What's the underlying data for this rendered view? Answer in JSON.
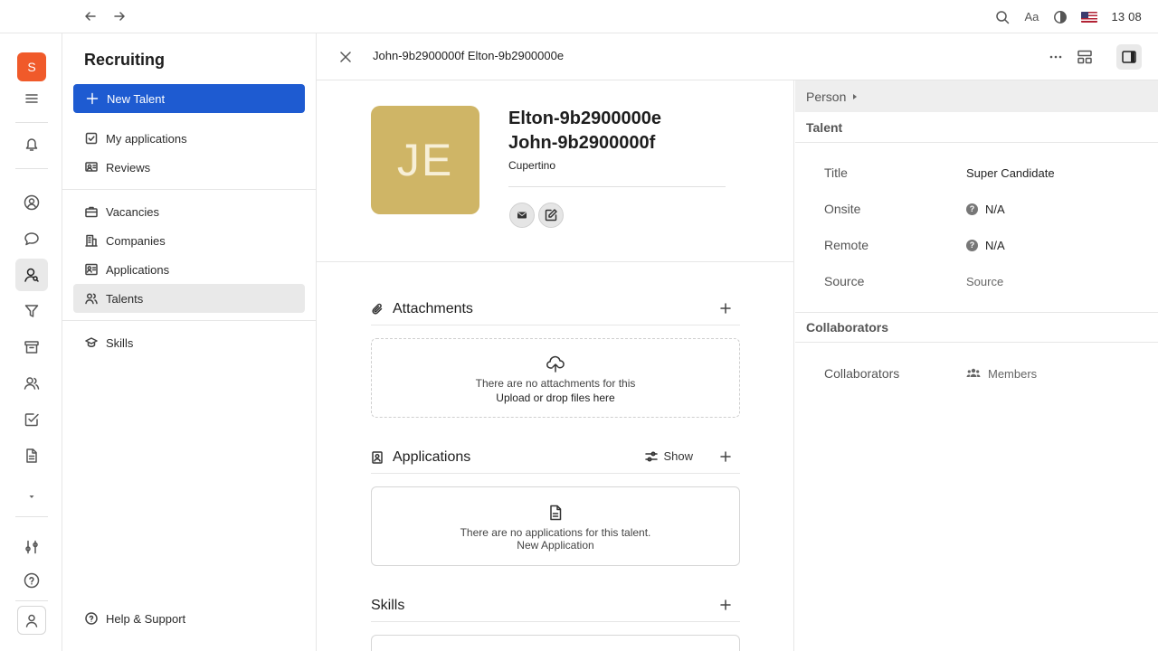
{
  "topbar": {
    "back_icon": "arrow-left-icon",
    "forward_icon": "arrow-right-icon",
    "font_label": "Aa",
    "time": "13 08",
    "flag": "us-flag"
  },
  "rail": {
    "workspace_initial": "S",
    "workspace_color": "#f05a2a",
    "active_item": "recruiting"
  },
  "sidebar": {
    "title": "Recruiting",
    "new_button": "New Talent",
    "items": [
      {
        "label": "My applications",
        "icon": "checkbox-icon"
      },
      {
        "label": "Reviews",
        "icon": "reviews-icon"
      },
      {
        "label": "Vacancies",
        "icon": "briefcase-icon"
      },
      {
        "label": "Companies",
        "icon": "building-icon"
      },
      {
        "label": "Applications",
        "icon": "id-card-icon"
      },
      {
        "label": "Talents",
        "icon": "people-icon",
        "active": true
      },
      {
        "label": "Skills",
        "icon": "graduation-cap-icon"
      }
    ],
    "help": "Help & Support"
  },
  "header": {
    "title": "John-9b2900000f Elton-9b2900000e"
  },
  "talent": {
    "initials": "JE",
    "avatar_color": "#cfb566",
    "last_name": "Elton-9b2900000e",
    "first_name": "John-9b2900000f",
    "location": "Cupertino"
  },
  "attachments": {
    "title": "Attachments",
    "empty_text": "There are no attachments for this",
    "upload_link": "Upload or drop files here"
  },
  "applications": {
    "title": "Applications",
    "show_label": "Show",
    "empty_text": "There are no applications for this talent.",
    "new_link": "New Application"
  },
  "skills": {
    "title": "Skills"
  },
  "props": {
    "person_label": "Person",
    "talent_group": "Talent",
    "fields": [
      {
        "label": "Title",
        "value": "Super Candidate"
      },
      {
        "label": "Onsite",
        "value": "N/A"
      },
      {
        "label": "Remote",
        "value": "N/A"
      },
      {
        "label": "Source",
        "value": "Source"
      }
    ],
    "collaborators_group": "Collaborators",
    "collaborators_label": "Collaborators",
    "collaborators_value": "Members"
  },
  "colors": {
    "accent": "#1e5bd1",
    "active_bg": "#e9e9e9"
  }
}
